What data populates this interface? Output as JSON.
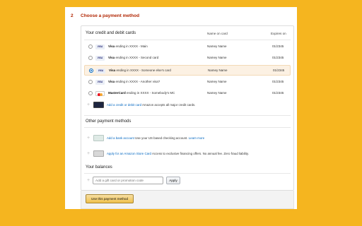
{
  "step": {
    "number": "2",
    "title": "Choose a payment method"
  },
  "cards_section": {
    "title": "Your credit and debit cards",
    "col_name": "Name on card",
    "col_expires": "Expires on",
    "cards": [
      {
        "brand": "Visa",
        "logo_label": "VISA",
        "suffix": " ending in XXXX - Main",
        "name": "Namey Name",
        "expires": "01/2345",
        "selected": false
      },
      {
        "brand": "Visa",
        "logo_label": "VISA",
        "suffix": " ending in XXXX - Second card",
        "name": "Namey Name",
        "expires": "01/2345",
        "selected": false
      },
      {
        "brand": "Visa",
        "logo_label": "VISA",
        "suffix": " ending in XXXX - Someone else's card",
        "name": "Namey Name",
        "expires": "01/2345",
        "selected": true
      },
      {
        "brand": "Visa",
        "logo_label": "VISA",
        "suffix": " ending in XXXX - Another visa?",
        "name": "Namey Name",
        "expires": "01/2345",
        "selected": false
      },
      {
        "brand": "MasterCard",
        "logo_label": "",
        "suffix": " ending in XXXX - Somebody's MC",
        "name": "Namey Name",
        "expires": "01/2345",
        "selected": false
      }
    ],
    "add_card_link": "Add a credit or debit card",
    "add_card_note": " Amazon accepts all major credit cards."
  },
  "other_section": {
    "title": "Other payment methods",
    "bank_link": "Add a bank account",
    "bank_text": " Use your US based checking account. ",
    "bank_learn": "Learn more",
    "store_link": "Apply for an Amazon Store Card",
    "store_text": " Access to exclusive financing offers. No annual fee. Zero fraud liability."
  },
  "balances_section": {
    "title": "Your balances",
    "gift_placeholder": "Add a gift card or promotion code",
    "apply_label": "Apply"
  },
  "footer": {
    "use_button": "Use this payment method"
  },
  "colors": {
    "background": "#f5b51f",
    "step_title": "#b12704",
    "link": "#0066c0",
    "selected_row": "#fcf1e3",
    "primary_button": "#f0c14b"
  }
}
